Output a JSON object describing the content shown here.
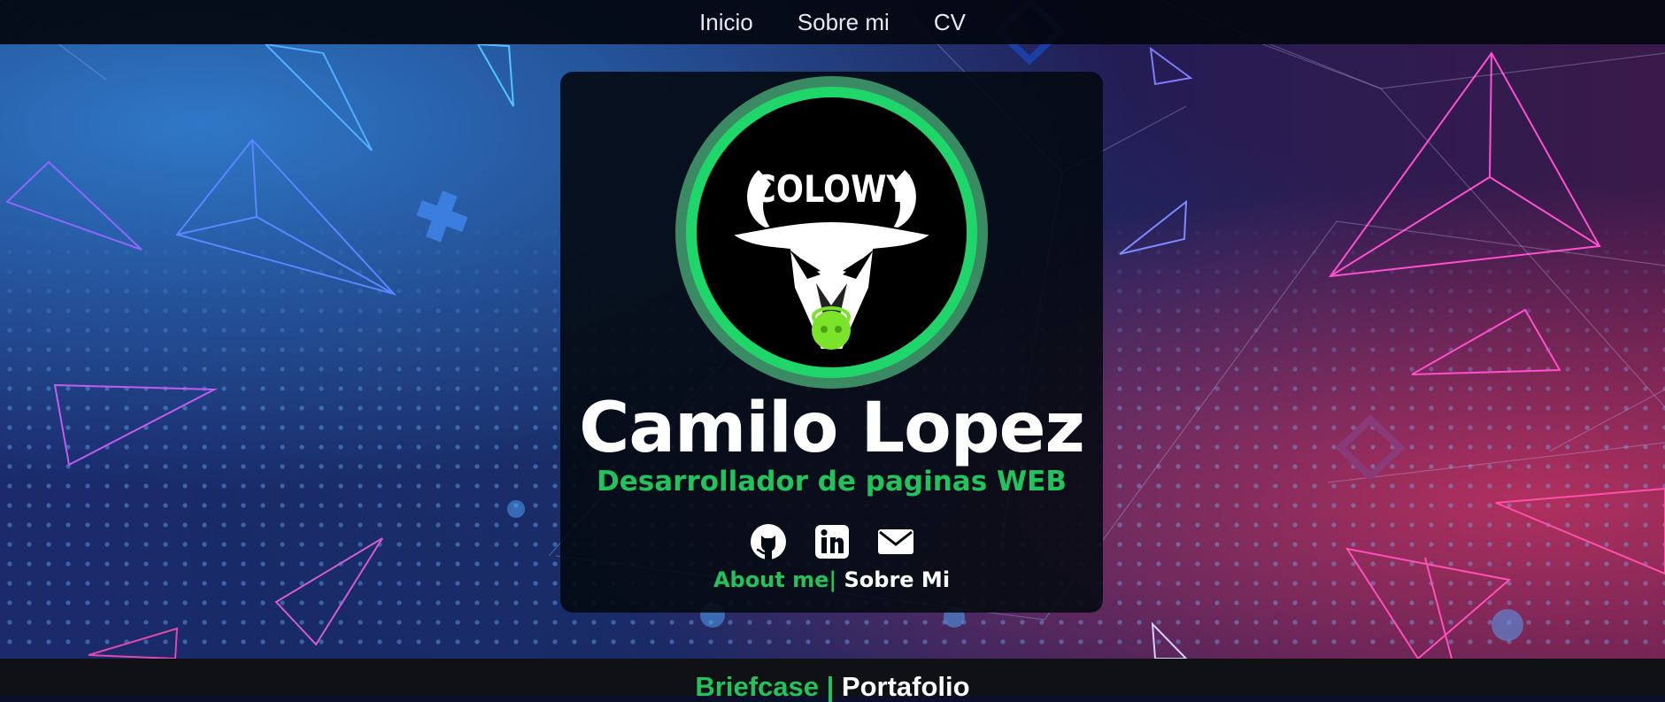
{
  "nav": {
    "items": [
      {
        "label": "Inicio"
      },
      {
        "label": "Sobre mi"
      },
      {
        "label": "CV"
      }
    ]
  },
  "profile": {
    "logo_text": "COLOWY",
    "name": "Camilo Lopez",
    "subtitle": "Desarrollador de paginas WEB",
    "socials": [
      {
        "icon": "github-icon"
      },
      {
        "icon": "linkedin-icon"
      },
      {
        "icon": "email-icon"
      }
    ],
    "about_en": "About me|",
    "about_es": " Sobre Mi"
  },
  "section": {
    "title_en": "Briefcase | ",
    "title_es": "Portafolio"
  },
  "colors": {
    "accent": "#22c35c",
    "ring_outer": "#3a8a64",
    "ring_inner": "#1fd66a",
    "card_bg": "#040a12",
    "nav_bg": "#03060e"
  }
}
